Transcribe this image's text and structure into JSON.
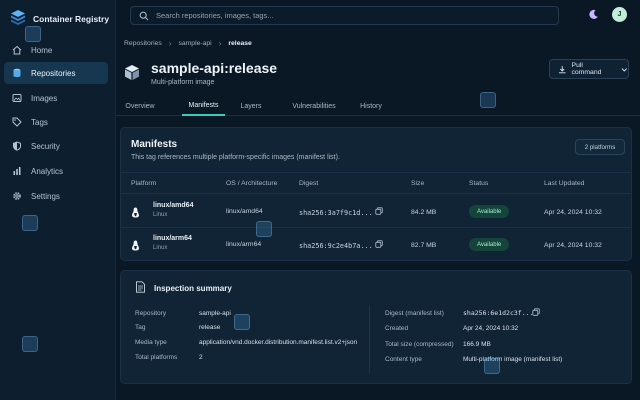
{
  "app": {
    "name": "Container Registry"
  },
  "sidebar": {
    "items": [
      {
        "label": "Home",
        "icon": "home-icon"
      },
      {
        "label": "Repositories",
        "icon": "database-icon",
        "active": true
      },
      {
        "label": "Images",
        "icon": "image-icon"
      },
      {
        "label": "Tags",
        "icon": "tag-icon"
      },
      {
        "label": "Security",
        "icon": "shield-icon"
      },
      {
        "label": "Analytics",
        "icon": "chart-icon"
      },
      {
        "label": "Settings",
        "icon": "gear-icon"
      }
    ]
  },
  "search": {
    "placeholder": "Search repositories, images, tags..."
  },
  "user": {
    "initial": "J"
  },
  "breadcrumb": [
    "Repositories",
    "sample-api",
    "release"
  ],
  "header": {
    "title": "sample-api:release",
    "subtitle": "Multi-platform image",
    "pull_label": "Pull command"
  },
  "tabs": [
    "Overview",
    "Manifests",
    "Layers",
    "Vulnerabilities",
    "History"
  ],
  "active_tab": "Manifests",
  "manifests": {
    "title": "Manifests",
    "description": "This tag references multiple platform-specific images (manifest list).",
    "platform_count": "2 platforms",
    "columns": [
      "Platform",
      "OS / Architecture",
      "Digest",
      "Size",
      "Status",
      "Last Updated"
    ],
    "rows": [
      {
        "platform": "linux/amd64",
        "os": "Linux",
        "arch": "linux/amd64",
        "digest": "sha256:3a7f9c1d...",
        "size": "84.2 MB",
        "status": "Available",
        "updated": "Apr 24, 2024 10:32"
      },
      {
        "platform": "linux/arm64",
        "os": "Linux",
        "arch": "linux/arm64",
        "digest": "sha256:9c2e4b7a...",
        "size": "82.7 MB",
        "status": "Available",
        "updated": "Apr 24, 2024 10:32"
      }
    ]
  },
  "summary": {
    "title": "Inspection summary",
    "left": [
      {
        "label": "Repository",
        "value": "sample-api"
      },
      {
        "label": "Tag",
        "value": "release"
      },
      {
        "label": "Media type",
        "value": "application/vnd.docker.distribution.manifest.list.v2+json"
      },
      {
        "label": "Total platforms",
        "value": "2"
      }
    ],
    "right": [
      {
        "label": "Digest (manifest list)",
        "value": "sha256:6e1d2c3f..."
      },
      {
        "label": "Created",
        "value": "Apr 24, 2024 10:32"
      },
      {
        "label": "Total size (compressed)",
        "value": "166.9 MB"
      },
      {
        "label": "Content type",
        "value": "Multi-platform image (manifest list)"
      }
    ]
  },
  "colors": {
    "accent": "#3ec9b6",
    "brand": "#4da3f0",
    "status_ok": "#14443a"
  }
}
